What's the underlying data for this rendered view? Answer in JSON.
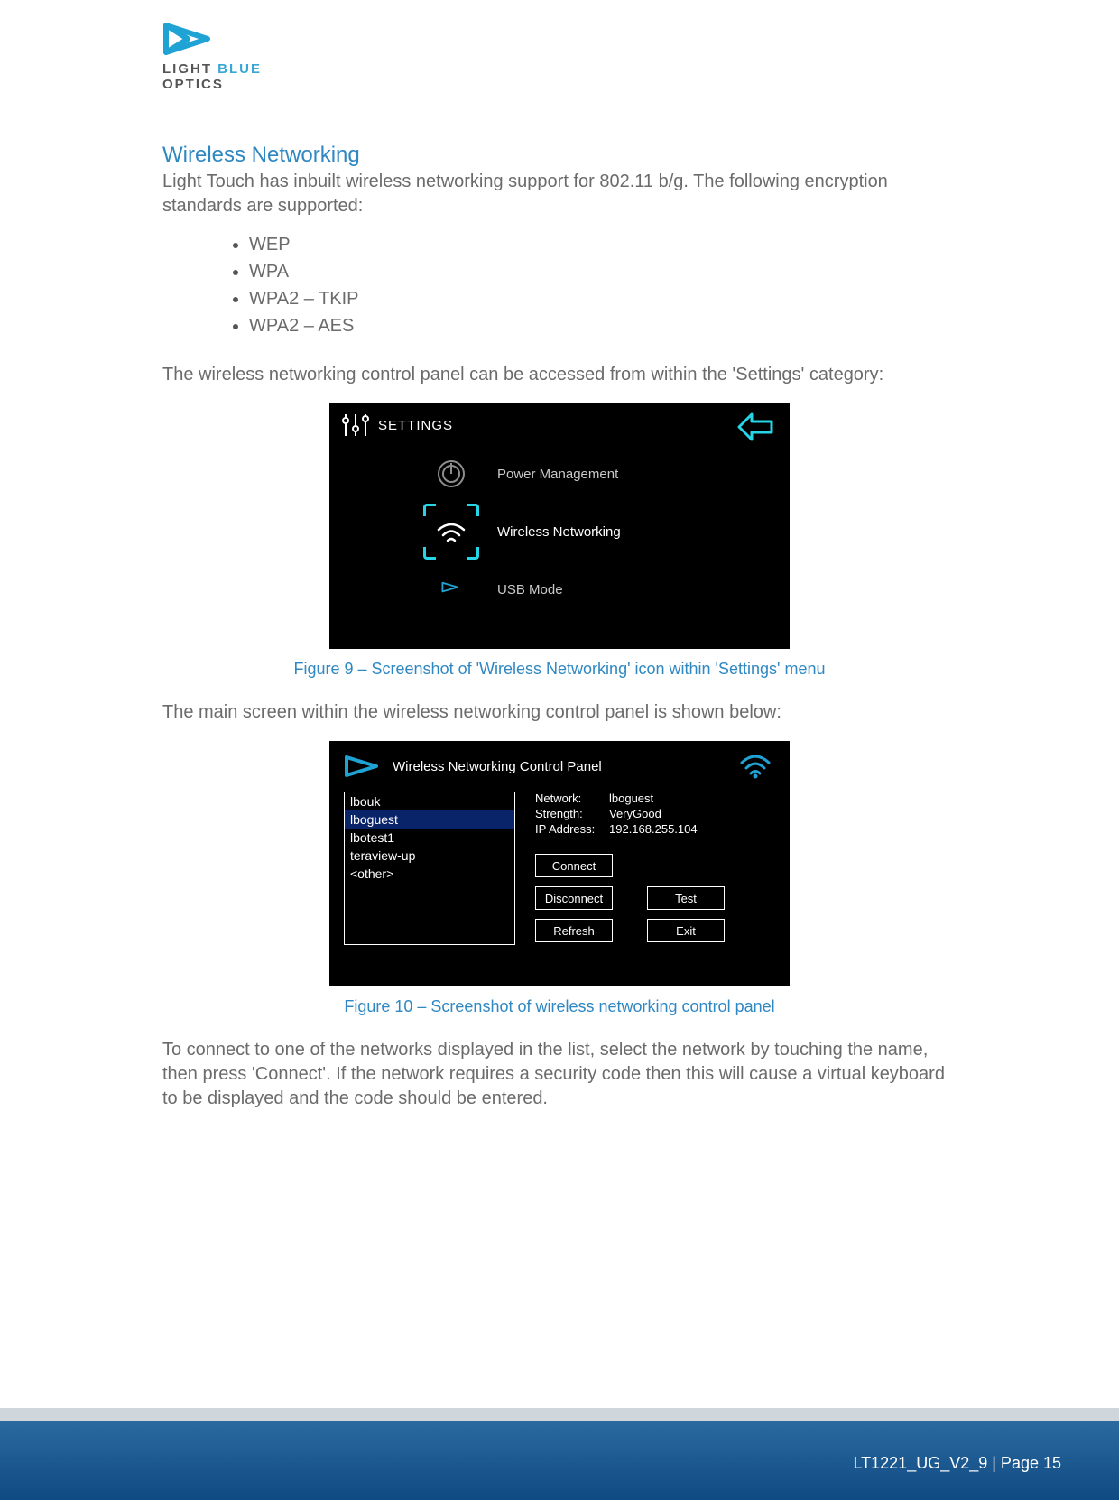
{
  "logo": {
    "line1": "LIGHT ",
    "line1_blue": "BLUE",
    "line2": "OPTICS"
  },
  "section": {
    "title": "Wireless Networking",
    "intro": "Light Touch has inbuilt wireless networking support for 802.11 b/g. The following encryption standards are supported:",
    "enc": [
      "WEP",
      "WPA",
      "WPA2 – TKIP",
      "WPA2 – AES"
    ],
    "after_list": "The wireless networking control panel can be accessed from within the 'Settings' category:",
    "fig9_caption": "Figure 9 – Screenshot of 'Wireless Networking' icon within 'Settings' menu",
    "after_fig9": "The main screen within the wireless networking control panel is shown below:",
    "fig10_caption": "Figure 10 – Screenshot of wireless networking control panel",
    "after_fig10": "To connect to one of the networks displayed in the list, select the network by touching the name, then press 'Connect'. If the network requires a security code then this will cause a virtual keyboard to be displayed and the code should be entered."
  },
  "fig9": {
    "title": "SETTINGS",
    "items": [
      {
        "label": "Power Management",
        "icon": "power-icon",
        "selected": false
      },
      {
        "label": "Wireless Networking",
        "icon": "wifi-icon",
        "selected": true
      },
      {
        "label": "USB Mode",
        "icon": "usb-icon",
        "selected": false
      }
    ]
  },
  "fig10": {
    "title": "Wireless Networking Control Panel",
    "networks": [
      "lbouk",
      "lboguest",
      "lbotest1",
      "teraview-up",
      "<other>"
    ],
    "selected_index": 1,
    "info": {
      "network_label": "Network:",
      "network_value": "lboguest",
      "strength_label": "Strength:",
      "strength_value": "VeryGood",
      "ip_label": "IP Address:",
      "ip_value": "192.168.255.104"
    },
    "buttons": {
      "connect": "Connect",
      "disconnect": "Disconnect",
      "refresh": "Refresh",
      "test": "Test",
      "exit": "Exit"
    }
  },
  "footer": {
    "text": "LT1221_UG_V2_9 | Page 15"
  }
}
